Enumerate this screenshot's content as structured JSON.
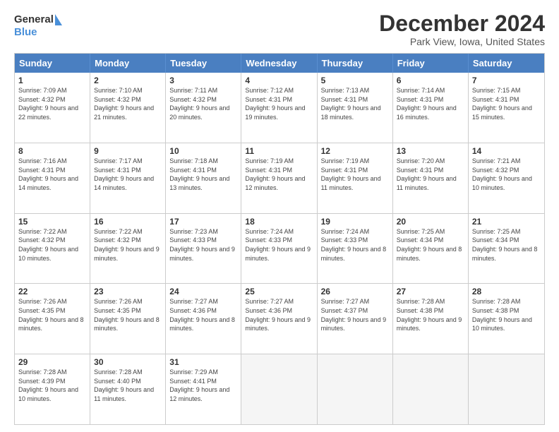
{
  "logo": {
    "line1": "General",
    "line2": "Blue"
  },
  "title": "December 2024",
  "subtitle": "Park View, Iowa, United States",
  "header_days": [
    "Sunday",
    "Monday",
    "Tuesday",
    "Wednesday",
    "Thursday",
    "Friday",
    "Saturday"
  ],
  "weeks": [
    [
      {
        "day": "1",
        "sunrise": "Sunrise: 7:09 AM",
        "sunset": "Sunset: 4:32 PM",
        "daylight": "Daylight: 9 hours and 22 minutes."
      },
      {
        "day": "2",
        "sunrise": "Sunrise: 7:10 AM",
        "sunset": "Sunset: 4:32 PM",
        "daylight": "Daylight: 9 hours and 21 minutes."
      },
      {
        "day": "3",
        "sunrise": "Sunrise: 7:11 AM",
        "sunset": "Sunset: 4:32 PM",
        "daylight": "Daylight: 9 hours and 20 minutes."
      },
      {
        "day": "4",
        "sunrise": "Sunrise: 7:12 AM",
        "sunset": "Sunset: 4:31 PM",
        "daylight": "Daylight: 9 hours and 19 minutes."
      },
      {
        "day": "5",
        "sunrise": "Sunrise: 7:13 AM",
        "sunset": "Sunset: 4:31 PM",
        "daylight": "Daylight: 9 hours and 18 minutes."
      },
      {
        "day": "6",
        "sunrise": "Sunrise: 7:14 AM",
        "sunset": "Sunset: 4:31 PM",
        "daylight": "Daylight: 9 hours and 16 minutes."
      },
      {
        "day": "7",
        "sunrise": "Sunrise: 7:15 AM",
        "sunset": "Sunset: 4:31 PM",
        "daylight": "Daylight: 9 hours and 15 minutes."
      }
    ],
    [
      {
        "day": "8",
        "sunrise": "Sunrise: 7:16 AM",
        "sunset": "Sunset: 4:31 PM",
        "daylight": "Daylight: 9 hours and 14 minutes."
      },
      {
        "day": "9",
        "sunrise": "Sunrise: 7:17 AM",
        "sunset": "Sunset: 4:31 PM",
        "daylight": "Daylight: 9 hours and 14 minutes."
      },
      {
        "day": "10",
        "sunrise": "Sunrise: 7:18 AM",
        "sunset": "Sunset: 4:31 PM",
        "daylight": "Daylight: 9 hours and 13 minutes."
      },
      {
        "day": "11",
        "sunrise": "Sunrise: 7:19 AM",
        "sunset": "Sunset: 4:31 PM",
        "daylight": "Daylight: 9 hours and 12 minutes."
      },
      {
        "day": "12",
        "sunrise": "Sunrise: 7:19 AM",
        "sunset": "Sunset: 4:31 PM",
        "daylight": "Daylight: 9 hours and 11 minutes."
      },
      {
        "day": "13",
        "sunrise": "Sunrise: 7:20 AM",
        "sunset": "Sunset: 4:31 PM",
        "daylight": "Daylight: 9 hours and 11 minutes."
      },
      {
        "day": "14",
        "sunrise": "Sunrise: 7:21 AM",
        "sunset": "Sunset: 4:32 PM",
        "daylight": "Daylight: 9 hours and 10 minutes."
      }
    ],
    [
      {
        "day": "15",
        "sunrise": "Sunrise: 7:22 AM",
        "sunset": "Sunset: 4:32 PM",
        "daylight": "Daylight: 9 hours and 10 minutes."
      },
      {
        "day": "16",
        "sunrise": "Sunrise: 7:22 AM",
        "sunset": "Sunset: 4:32 PM",
        "daylight": "Daylight: 9 hours and 9 minutes."
      },
      {
        "day": "17",
        "sunrise": "Sunrise: 7:23 AM",
        "sunset": "Sunset: 4:33 PM",
        "daylight": "Daylight: 9 hours and 9 minutes."
      },
      {
        "day": "18",
        "sunrise": "Sunrise: 7:24 AM",
        "sunset": "Sunset: 4:33 PM",
        "daylight": "Daylight: 9 hours and 9 minutes."
      },
      {
        "day": "19",
        "sunrise": "Sunrise: 7:24 AM",
        "sunset": "Sunset: 4:33 PM",
        "daylight": "Daylight: 9 hours and 8 minutes."
      },
      {
        "day": "20",
        "sunrise": "Sunrise: 7:25 AM",
        "sunset": "Sunset: 4:34 PM",
        "daylight": "Daylight: 9 hours and 8 minutes."
      },
      {
        "day": "21",
        "sunrise": "Sunrise: 7:25 AM",
        "sunset": "Sunset: 4:34 PM",
        "daylight": "Daylight: 9 hours and 8 minutes."
      }
    ],
    [
      {
        "day": "22",
        "sunrise": "Sunrise: 7:26 AM",
        "sunset": "Sunset: 4:35 PM",
        "daylight": "Daylight: 9 hours and 8 minutes."
      },
      {
        "day": "23",
        "sunrise": "Sunrise: 7:26 AM",
        "sunset": "Sunset: 4:35 PM",
        "daylight": "Daylight: 9 hours and 8 minutes."
      },
      {
        "day": "24",
        "sunrise": "Sunrise: 7:27 AM",
        "sunset": "Sunset: 4:36 PM",
        "daylight": "Daylight: 9 hours and 8 minutes."
      },
      {
        "day": "25",
        "sunrise": "Sunrise: 7:27 AM",
        "sunset": "Sunset: 4:36 PM",
        "daylight": "Daylight: 9 hours and 9 minutes."
      },
      {
        "day": "26",
        "sunrise": "Sunrise: 7:27 AM",
        "sunset": "Sunset: 4:37 PM",
        "daylight": "Daylight: 9 hours and 9 minutes."
      },
      {
        "day": "27",
        "sunrise": "Sunrise: 7:28 AM",
        "sunset": "Sunset: 4:38 PM",
        "daylight": "Daylight: 9 hours and 9 minutes."
      },
      {
        "day": "28",
        "sunrise": "Sunrise: 7:28 AM",
        "sunset": "Sunset: 4:38 PM",
        "daylight": "Daylight: 9 hours and 10 minutes."
      }
    ],
    [
      {
        "day": "29",
        "sunrise": "Sunrise: 7:28 AM",
        "sunset": "Sunset: 4:39 PM",
        "daylight": "Daylight: 9 hours and 10 minutes."
      },
      {
        "day": "30",
        "sunrise": "Sunrise: 7:28 AM",
        "sunset": "Sunset: 4:40 PM",
        "daylight": "Daylight: 9 hours and 11 minutes."
      },
      {
        "day": "31",
        "sunrise": "Sunrise: 7:29 AM",
        "sunset": "Sunset: 4:41 PM",
        "daylight": "Daylight: 9 hours and 12 minutes."
      },
      null,
      null,
      null,
      null
    ]
  ]
}
